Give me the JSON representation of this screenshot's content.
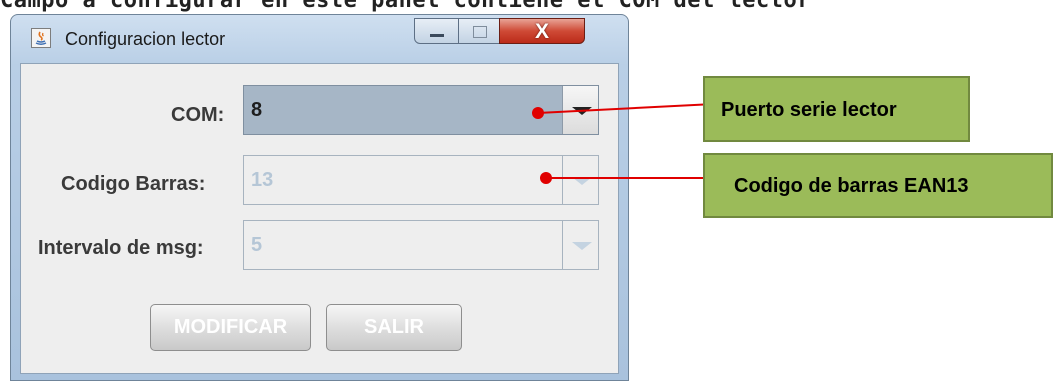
{
  "background_strip": {
    "text": "Campo a configurar en este panel contiene el COM del lector"
  },
  "window": {
    "title": "Configuracion lector",
    "controls": {
      "close_glyph": "X"
    }
  },
  "form": {
    "com": {
      "label": "COM:",
      "value": "8"
    },
    "barcode": {
      "label": "Codigo Barras:",
      "value": "13"
    },
    "interval": {
      "label": "Intervalo de msg:",
      "value": "5"
    }
  },
  "buttons": {
    "modify": "MODIFICAR",
    "exit": "SALIR"
  },
  "annotations": {
    "port": "Puerto serie lector",
    "barcode": "Codigo de barras EAN13"
  },
  "colors": {
    "callout_fill": "#9bbb59",
    "callout_border": "#71893f",
    "annotation_line": "#e00000",
    "active_combo": "#a6b6c6",
    "close_button": "#cf4a36"
  },
  "icons": [
    "java-app-icon",
    "minimize-icon",
    "maximize-icon",
    "close-icon",
    "dropdown-arrow-icon"
  ]
}
